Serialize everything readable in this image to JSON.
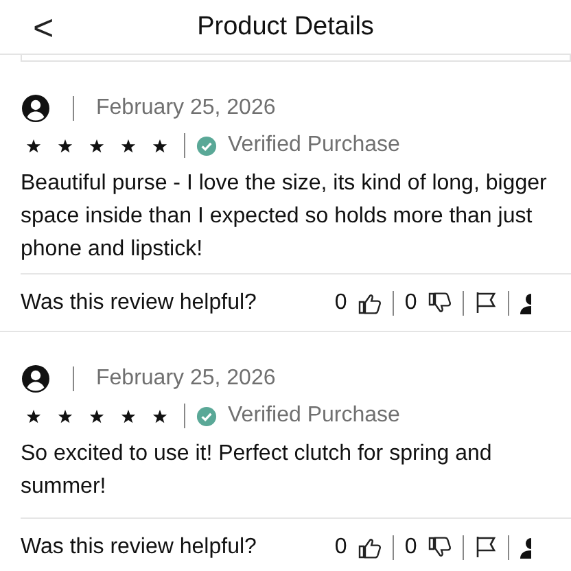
{
  "header": {
    "back": "<",
    "title": "Product Details"
  },
  "reviews": [
    {
      "date": "February 25, 2026",
      "stars": 5,
      "verified": true,
      "badge": "Verified Purchase",
      "text": "Beautiful purse - I love the size, its kind of long,  bigger space inside than I expected so holds more than just phone and lipstick!",
      "helpful_label": "Was this review helpful?",
      "up_count": "0",
      "down_count": "0"
    },
    {
      "date": "February 25, 2026",
      "stars": 5,
      "verified": true,
      "badge": "Verified Purchase",
      "text": "So excited to use it! Perfect clutch for spring and summer!",
      "helpful_label": "Was this review helpful?",
      "up_count": "0",
      "down_count": "0"
    }
  ]
}
